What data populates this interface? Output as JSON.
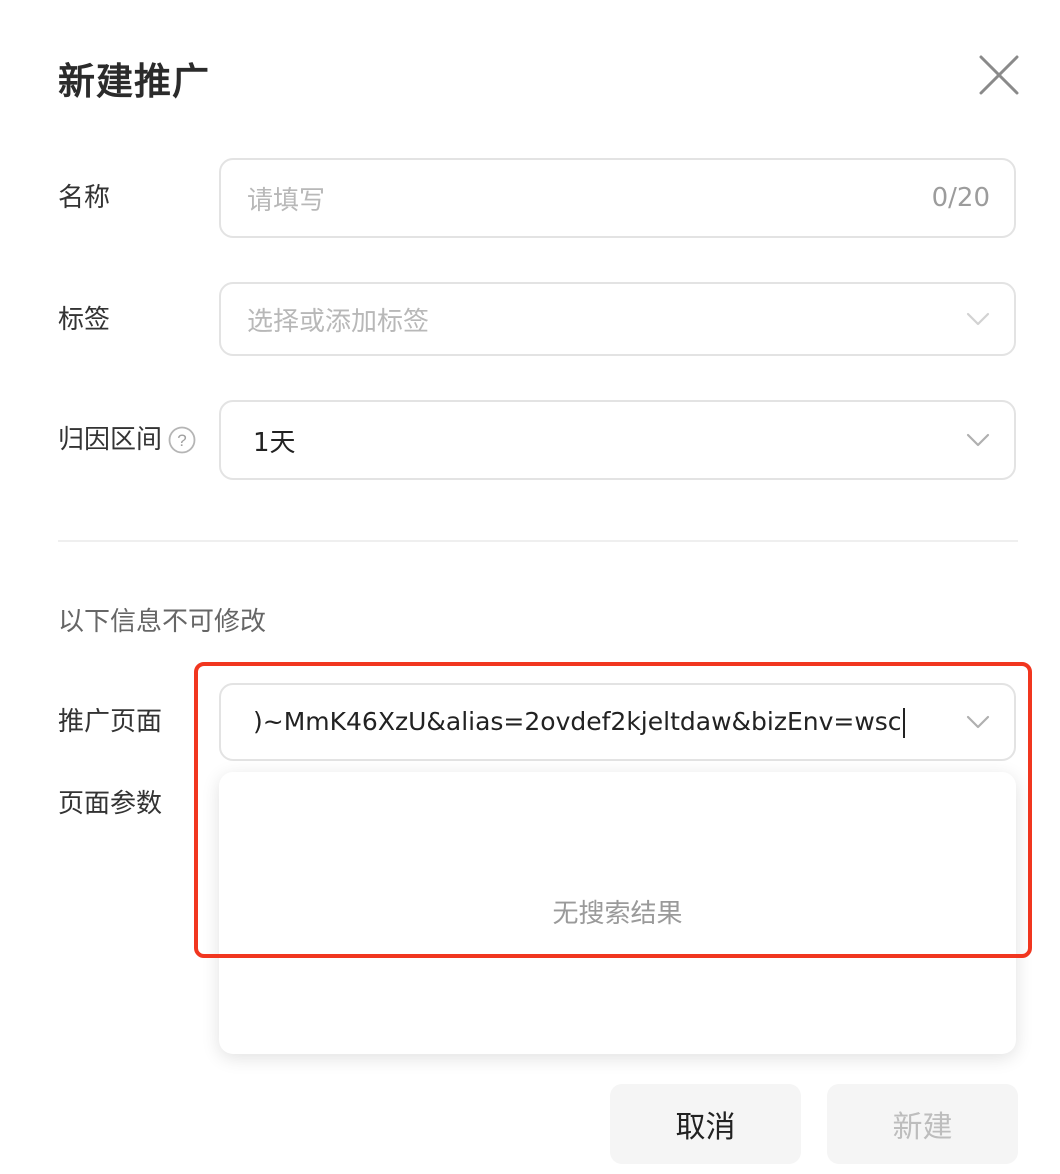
{
  "dialog": {
    "title": "新建推广"
  },
  "form": {
    "name": {
      "label": "名称",
      "placeholder": "请填写",
      "counter": "0/20"
    },
    "tags": {
      "label": "标签",
      "placeholder": "选择或添加标签"
    },
    "attribution": {
      "label": "归因区间",
      "value": "1天"
    }
  },
  "readonly_section": {
    "note": "以下信息不可修改",
    "promo_page": {
      "label": "推广页面",
      "value": ")~MmK46XzU&alias=2ovdef2kjeltdaw&bizEnv=wsc"
    },
    "page_params": {
      "label": "页面参数"
    },
    "dropdown": {
      "empty_text": "无搜索结果"
    }
  },
  "footer": {
    "cancel_label": "取消",
    "create_label": "新建"
  },
  "colors": {
    "highlight_border": "#f1361f",
    "button_bg": "#f5f5f5",
    "disabled_text": "#bdbdbd"
  },
  "icons": {
    "close": "close-icon",
    "help": "question-circle-icon",
    "dropdown": "chevron-down-icon"
  }
}
